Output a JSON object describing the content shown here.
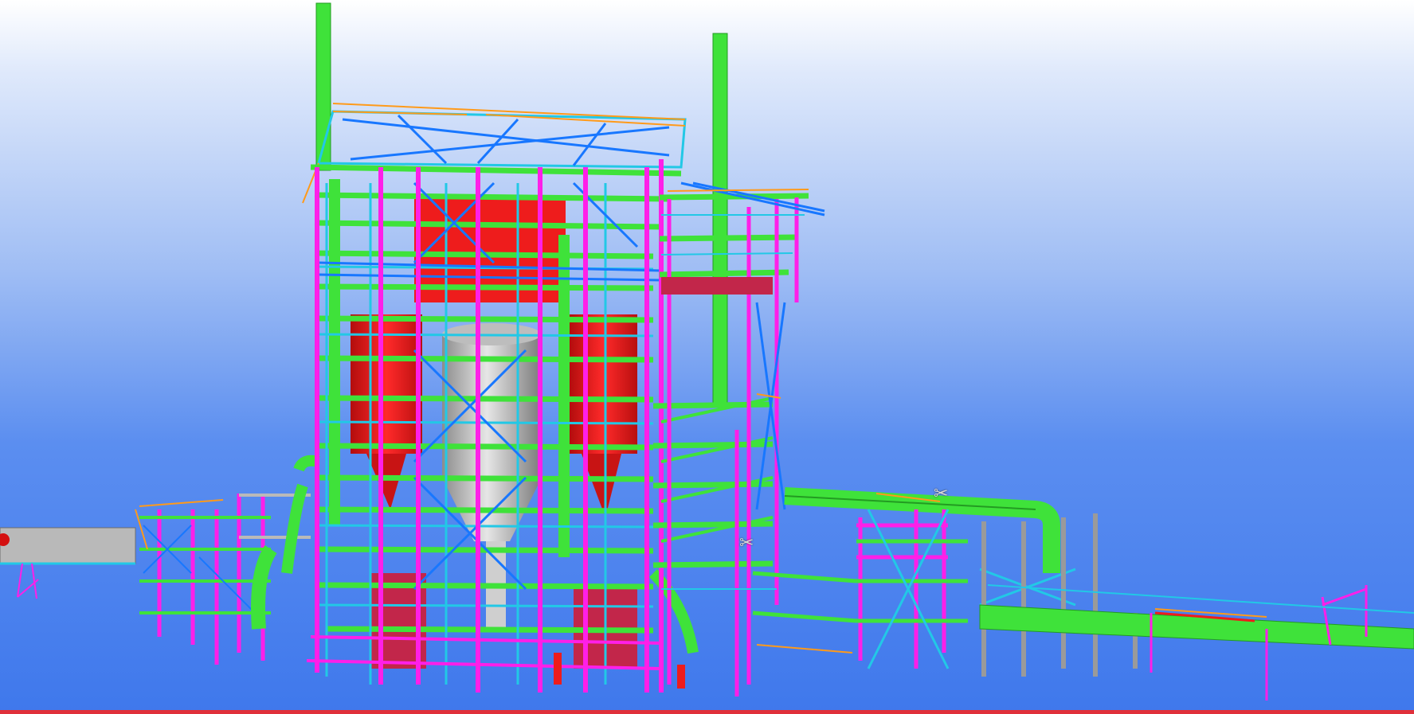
{
  "viewer": {
    "background_top": "#ffffff",
    "background_bottom": "#3f78ec",
    "bottom_strip_color": "#e0303a"
  },
  "palette": {
    "pipe": "#3fe23a",
    "column": "#ff1fe8",
    "bracing": "#1877ff",
    "secondary": "#22c8e6",
    "railing": "#ff9a1a",
    "vessel": "#ee1c1c",
    "vessel_dark": "#c2264a",
    "silo": "#cfcfcf",
    "conveyor": "#b9b9b9"
  },
  "markers": [
    {
      "icon": "scissors-icon",
      "glyph": "✂"
    },
    {
      "icon": "scissors-icon",
      "glyph": "✂"
    }
  ]
}
